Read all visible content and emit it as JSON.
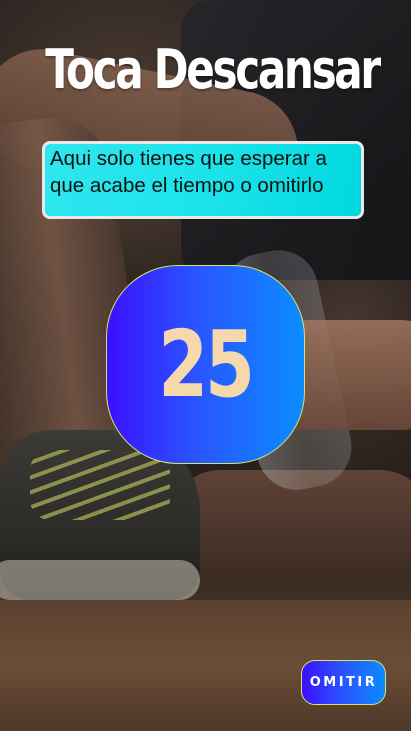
{
  "header": {
    "title": "Toca Descansar"
  },
  "info": {
    "text": " Aqui solo tienes que esperar a que acabe el tiempo o omitirlo"
  },
  "timer": {
    "value": "25"
  },
  "actions": {
    "skip_label": "OMITIR"
  },
  "colors": {
    "info_bg": "#1de3ea",
    "button_gradient_start": "#3a10ff",
    "button_gradient_end": "#0b8cff",
    "timer_text": "#f5d9ad",
    "button_border": "#d6e36a"
  }
}
